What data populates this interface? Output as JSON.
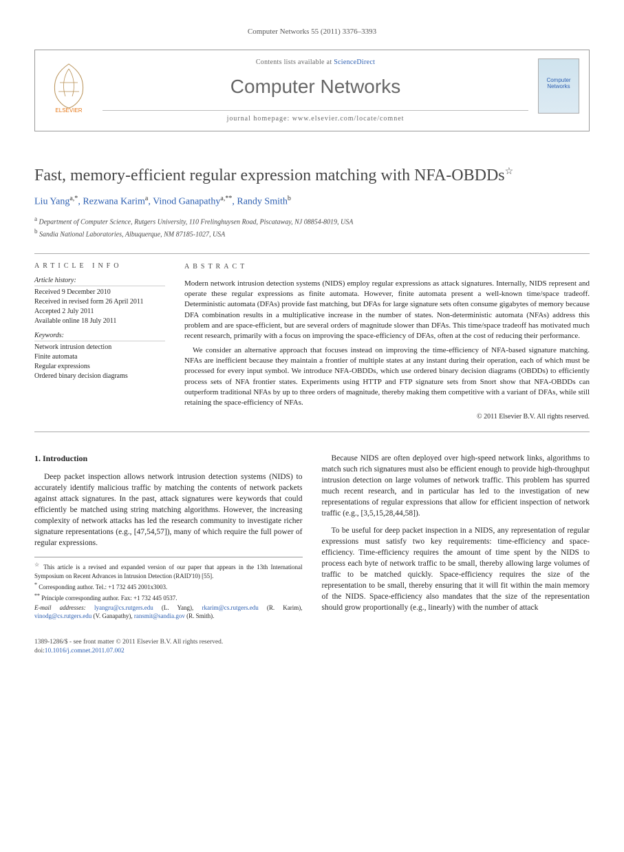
{
  "citation": "Computer Networks 55 (2011) 3376–3393",
  "header": {
    "contents_prefix": "Contents lists available at ",
    "contents_link": "ScienceDirect",
    "journal": "Computer Networks",
    "homepage_prefix": "journal homepage: ",
    "homepage_url": "www.elsevier.com/locate/comnet",
    "cover_text": "Computer Networks"
  },
  "title": "Fast, memory-efficient regular expression matching with NFA-OBDDs",
  "title_star": "☆",
  "authors_html_parts": [
    {
      "name": "Liu Yang",
      "sup": "a,*"
    },
    {
      "name": "Rezwana Karim",
      "sup": "a"
    },
    {
      "name": "Vinod Ganapathy",
      "sup": "a,**"
    },
    {
      "name": "Randy Smith",
      "sup": "b"
    }
  ],
  "affiliations": [
    {
      "sup": "a",
      "text": "Department of Computer Science, Rutgers University, 110 Frelinghuysen Road, Piscataway, NJ 08854-8019, USA"
    },
    {
      "sup": "b",
      "text": "Sandia National Laboratories, Albuquerque, NM 87185-1027, USA"
    }
  ],
  "article_info": {
    "heading": "ARTICLE INFO",
    "history_label": "Article history:",
    "history": [
      "Received 9 December 2010",
      "Received in revised form 26 April 2011",
      "Accepted 2 July 2011",
      "Available online 18 July 2011"
    ],
    "keywords_label": "Keywords:",
    "keywords": [
      "Network intrusion detection",
      "Finite automata",
      "Regular expressions",
      "Ordered binary decision diagrams"
    ]
  },
  "abstract": {
    "heading": "ABSTRACT",
    "p1": "Modern network intrusion detection systems (NIDS) employ regular expressions as attack signatures. Internally, NIDS represent and operate these regular expressions as finite automata. However, finite automata present a well-known time/space tradeoff. Deterministic automata (DFAs) provide fast matching, but DFAs for large signature sets often consume gigabytes of memory because DFA combination results in a multiplicative increase in the number of states. Non-deterministic automata (NFAs) address this problem and are space-efficient, but are several orders of magnitude slower than DFAs. This time/space tradeoff has motivated much recent research, primarily with a focus on improving the space-efficiency of DFAs, often at the cost of reducing their performance.",
    "p2": "We consider an alternative approach that focuses instead on improving the time-efficiency of NFA-based signature matching. NFAs are inefficient because they maintain a frontier of multiple states at any instant during their operation, each of which must be processed for every input symbol. We introduce NFA-OBDDs, which use ordered binary decision diagrams (OBDDs) to efficiently process sets of NFA frontier states. Experiments using HTTP and FTP signature sets from Snort show that NFA-OBDDs can outperform traditional NFAs by up to three orders of magnitude, thereby making them competitive with a variant of DFAs, while still retaining the space-efficiency of NFAs.",
    "copyright": "© 2011 Elsevier B.V. All rights reserved."
  },
  "section1": {
    "heading": "1. Introduction",
    "p1": "Deep packet inspection allows network intrusion detection systems (NIDS) to accurately identify malicious traffic by matching the contents of network packets against attack signatures. In the past, attack signatures were keywords that could efficiently be matched using string matching algorithms. However, the increasing complexity of network attacks has led the research community to investigate richer signature representations (e.g., [47,54,57]), many of which require the full power of regular expressions.",
    "p2": "Because NIDS are often deployed over high-speed network links, algorithms to match such rich signatures must also be efficient enough to provide high-throughput intrusion detection on large volumes of network traffic. This problem has spurred much recent research, and in particular has led to the investigation of new representations of regular expressions that allow for efficient inspection of network traffic (e.g., [3,5,15,28,44,58]).",
    "p3": "To be useful for deep packet inspection in a NIDS, any representation of regular expressions must satisfy two key requirements: time-efficiency and space-efficiency. Time-efficiency requires the amount of time spent by the NIDS to process each byte of network traffic to be small, thereby allowing large volumes of traffic to be matched quickly. Space-efficiency requires the size of the representation to be small, thereby ensuring that it will fit within the main memory of the NIDS. Space-efficiency also mandates that the size of the representation should grow proportionally (e.g., linearly) with the number of attack"
  },
  "footnotes": {
    "star": "This article is a revised and expanded version of our paper that appears in the 13th International Symposium on Recent Advances in Intrusion Detection (RAID'10) [55].",
    "corr1_label": "*",
    "corr1": "Corresponding author. Tel.: +1 732 445 2001x3003.",
    "corr2_label": "**",
    "corr2": "Principle corresponding author. Fax: +1 732 445 0537.",
    "email_label": "E-mail addresses:",
    "emails": [
      {
        "addr": "lyangru@cs.rutgers.edu",
        "who": "(L. Yang)"
      },
      {
        "addr": "rkarim@cs.rutgers.edu",
        "who": "(R. Karim)"
      },
      {
        "addr": "vinodg@cs.rutgers.edu",
        "who": "(V. Ganapathy)"
      },
      {
        "addr": "ransmit@sandia.gov",
        "who": "(R. Smith)"
      }
    ]
  },
  "doi": {
    "line1": "1389-1286/$ - see front matter © 2011 Elsevier B.V. All rights reserved.",
    "line2_prefix": "doi:",
    "line2_link": "10.1016/j.comnet.2011.07.002"
  }
}
